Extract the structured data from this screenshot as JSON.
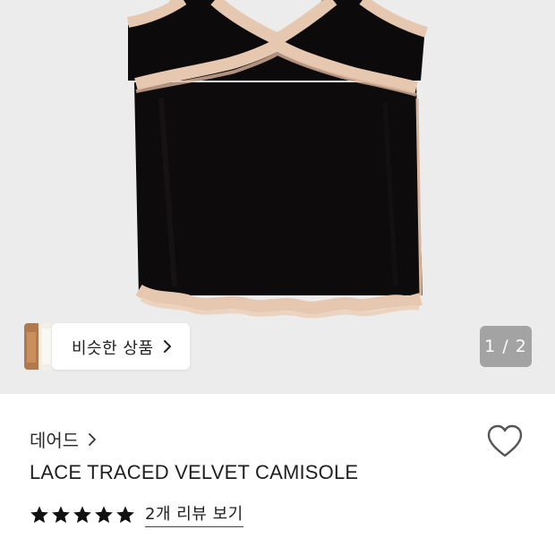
{
  "gallery": {
    "similar_products_label": "비슷한 상품",
    "page_indicator": "1 / 2",
    "current_image": 1,
    "total_images": 2,
    "image_description_icon": "velvet-camisole-photo"
  },
  "product": {
    "brand": "데어드",
    "name": "LACE TRACED VELVET CAMISOLE",
    "rating_stars": 5,
    "review_link_label": "2개 리뷰 보기"
  },
  "colors": {
    "gallery_bg": "#ececec",
    "velvet": "#0c0a0b",
    "lace": "#e6c7b0",
    "indicator_bg": "#a3a3a3",
    "star": "#111111",
    "text": "#222222"
  },
  "icons": {
    "chevron": "chevron-right-icon",
    "wishlist": "heart-outline-icon",
    "star": "star-filled-icon"
  }
}
